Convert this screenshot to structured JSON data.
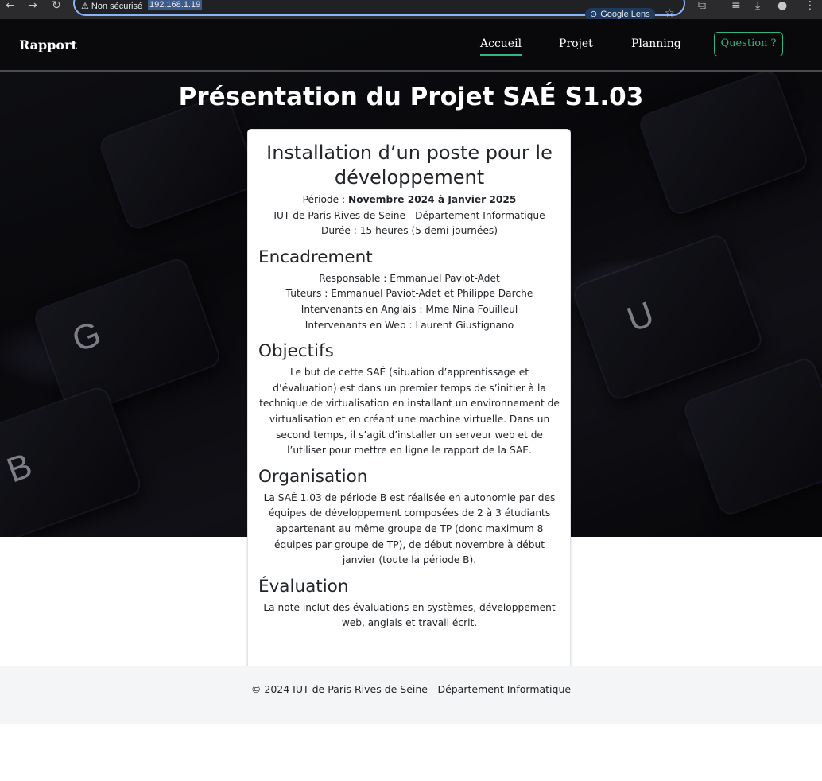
{
  "browser": {
    "back_icon": "back-arrow-icon",
    "forward_icon": "forward-arrow-icon",
    "reload_icon": "reload-icon",
    "security_label": "Non sécurisé",
    "url": "192.168.1.19",
    "lens_label": "Google Lens",
    "accent_color": "#8ab4f8"
  },
  "navbar": {
    "brand": "Rapport",
    "links": [
      "Accueil",
      "Projet",
      "Planning"
    ],
    "active_link": "Accueil",
    "question_button": "Question ?",
    "accent_color": "#2fb683"
  },
  "hero": {
    "title": "Présentation du Projet SAÉ S1.03",
    "key_letters": [
      "G",
      "U",
      "B"
    ]
  },
  "card": {
    "title": "Installation d’un poste pour le développement",
    "period_label": "Période : ",
    "period_value": "Novembre 2024 à Janvier 2025",
    "institution": "IUT de Paris Rives de Seine - Département Informatique",
    "duration": "Durée : 15 heures (5 demi-journées)",
    "encadrement": {
      "heading": "Encadrement",
      "lines": [
        "Responsable : Emmanuel Paviot-Adet",
        "Tuteurs : Emmanuel Paviot-Adet et Philippe Darche",
        "Intervenants en Anglais : Mme Nina Fouilleul",
        "Intervenants en Web : Laurent Giustignano"
      ]
    },
    "objectifs": {
      "heading": "Objectifs",
      "text": "Le but de cette SAÉ (situation d’apprentissage et d’évaluation) est dans un premier temps de s’initier à la technique de virtualisation en installant un environnement de virtualisation et en créant une machine virtuelle. Dans un second temps, il s’agit d’installer un serveur web et de l’utiliser pour mettre en ligne le rapport de la SAE."
    },
    "organisation": {
      "heading": "Organisation",
      "text": "La SAÉ 1.03 de période B est réalisée en autonomie par des équipes de développement composées de 2 à 3 étudiants appartenant au même groupe de TP (donc maximum 8 équipes par groupe de TP), de début novembre à début janvier (toute la période B)."
    },
    "evaluation": {
      "heading": "Évaluation",
      "text": "La note inclut des évaluations en systèmes, développement web, anglais et travail écrit."
    }
  },
  "footer": {
    "text": "© 2024 IUT de Paris Rives de Seine - Département Informatique"
  }
}
